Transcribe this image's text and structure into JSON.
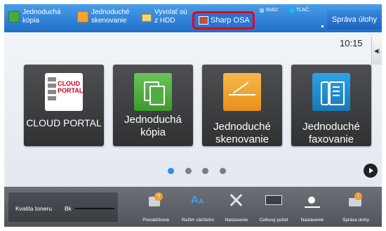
{
  "topbar": {
    "items": [
      {
        "label": "Jednoduchá\nkópia",
        "icon": "copy-icon"
      },
      {
        "label": "Jednoduché\nskenovanie",
        "icon": "scan-icon"
      },
      {
        "label": "Vyvolať sú\nz HDD",
        "icon": "folder-icon"
      }
    ],
    "osa_label": "Sharp OSA",
    "status_riad": "RIAD.",
    "status_tlac": "TLAČ.",
    "job_status_label": "Správa úlohy"
  },
  "clock": "10:15",
  "tiles": [
    {
      "label": "CLOUD PORTAL",
      "icon_text_1": "CLOUD",
      "icon_text_2": "PORTAL"
    },
    {
      "label": "Jednoduchá\nkópia"
    },
    {
      "label": "Jednoduché\nskenovanie"
    },
    {
      "label": "Jednoduché\nfaxovanie"
    }
  ],
  "pagination": {
    "pages": 4,
    "current": 1
  },
  "bottombar": {
    "toner_label": "Kvalita toneru",
    "toner_color": "Bk",
    "toner_level": 1.0,
    "items": [
      {
        "label": "Prevádzková\npríručka",
        "icon": "manual-icon"
      },
      {
        "label": "Režim väčšieho\nzobrazenia",
        "icon": "large-text-icon"
      },
      {
        "label": "Nastavenie",
        "icon": "settings-icon"
      },
      {
        "label": "Celkový počet",
        "icon": "counter-icon"
      },
      {
        "label": "Nastavenie\njasu",
        "icon": "brightness-icon"
      },
      {
        "label": "Správa úlohy",
        "icon": "job-status-icon"
      }
    ]
  },
  "colors": {
    "topbar": "#2f86dc",
    "highlight": "#e3001b",
    "copy_green": "#4caa3c",
    "scan_orange": "#f2a531",
    "fax_blue": "#1c8ccf",
    "active_dot": "#2f8ee6"
  }
}
